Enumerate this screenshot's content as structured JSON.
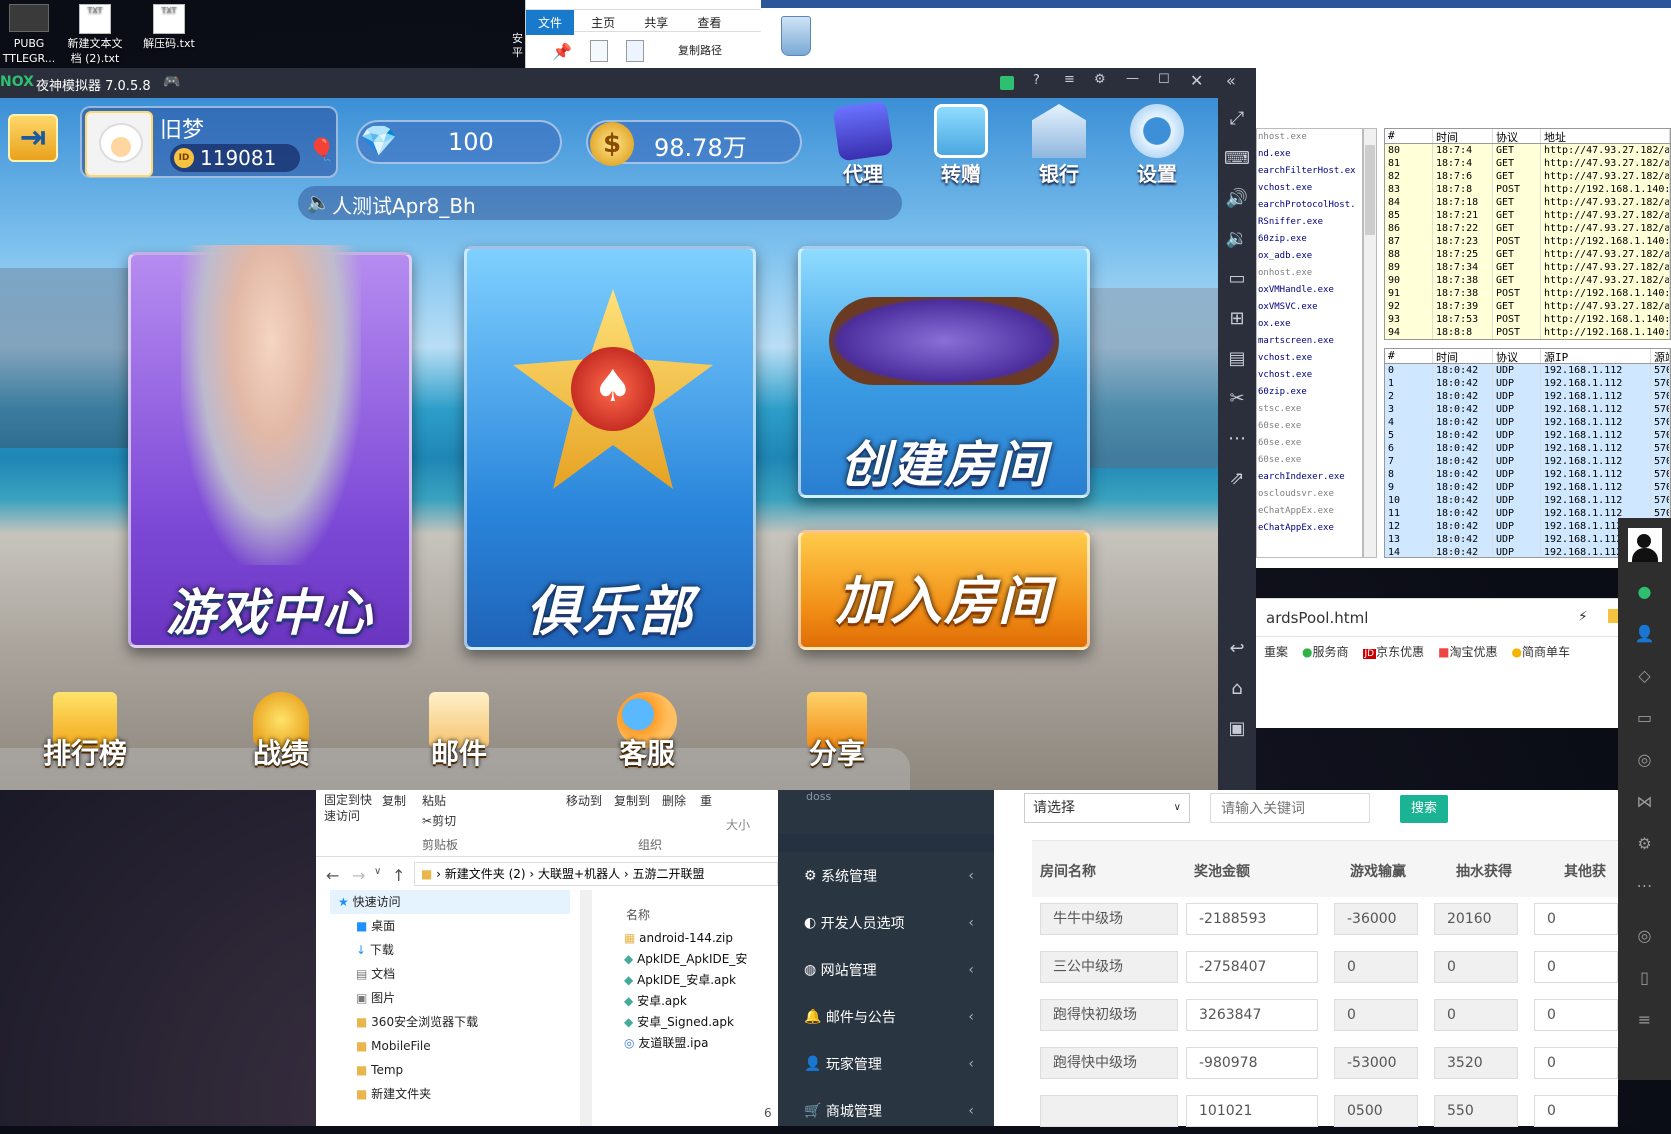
{
  "desktop": {
    "icons": [
      {
        "line1": "PUBG",
        "line2": "TTLEGR..."
      },
      {
        "line1": "新建文本文",
        "line2": "档 (2).txt",
        "badge": "TXT"
      },
      {
        "line1": "解压码.txt",
        "line2": "",
        "badge": "TXT"
      }
    ]
  },
  "explorer_top": {
    "tabs": [
      "文件",
      "主页",
      "共享",
      "查看"
    ],
    "copy_path": "复制路径",
    "side_text": [
      "安",
      "平"
    ]
  },
  "nox": {
    "title": "夜神模拟器 7.0.5.8",
    "logo": "NOX",
    "colors": {
      "titlebar": "#2b2f3b",
      "accent_green": "#2fbf71"
    }
  },
  "game": {
    "player_name": "旧梦",
    "player_id": "119081",
    "id_badge": "ID",
    "diamonds": "100",
    "gold": "98.78万",
    "top_icons": [
      "代理",
      "转赠",
      "银行",
      "设置"
    ],
    "marquee": "人测试Apr8_Bh",
    "panels": {
      "game_center": "游戏中心",
      "club": "俱乐部",
      "create_room": "创建房间",
      "join_room": "加入房间"
    },
    "bottom_icons": [
      "排行榜",
      "战绩",
      "邮件",
      "客服",
      "分享"
    ]
  },
  "sniffer": {
    "process_list": [
      "nhost.exe",
      "nd.exe",
      "earchFilterHost.ex",
      "vchost.exe",
      "earchProtocolHost.",
      "RSniffer.exe",
      "60zip.exe",
      "ox_adb.exe",
      "onhost.exe",
      "oxVMHandle.exe",
      "oxVMSVC.exe",
      "ox.exe",
      "martscreen.exe",
      "vchost.exe",
      "vchost.exe",
      "60zip.exe",
      "stsc.exe",
      "60se.exe",
      "60se.exe",
      "60se.exe",
      "earchIndexer.exe",
      "oscloudsvr.exe",
      "eChatAppEx.exe",
      "eChatAppEx.exe"
    ],
    "req_headers": [
      "#",
      "时间",
      "协议",
      "地址"
    ],
    "req_rows": [
      [
        "80",
        "18:7:4",
        "GET",
        "http://47.93.27.182/a"
      ],
      [
        "81",
        "18:7:4",
        "GET",
        "http://47.93.27.182/a"
      ],
      [
        "82",
        "18:7:6",
        "GET",
        "http://47.93.27.182/a"
      ],
      [
        "83",
        "18:7:8",
        "POST",
        "http://192.168.1.140:5"
      ],
      [
        "84",
        "18:7:18",
        "GET",
        "http://47.93.27.182/a"
      ],
      [
        "85",
        "18:7:21",
        "GET",
        "http://47.93.27.182/a"
      ],
      [
        "86",
        "18:7:22",
        "GET",
        "http://47.93.27.182/a"
      ],
      [
        "87",
        "18:7:23",
        "POST",
        "http://192.168.1.140:5"
      ],
      [
        "88",
        "18:7:25",
        "GET",
        "http://47.93.27.182/a"
      ],
      [
        "89",
        "18:7:34",
        "GET",
        "http://47.93.27.182/a"
      ],
      [
        "90",
        "18:7:38",
        "GET",
        "http://47.93.27.182/a"
      ],
      [
        "91",
        "18:7:38",
        "POST",
        "http://192.168.1.140:5"
      ],
      [
        "92",
        "18:7:39",
        "GET",
        "http://47.93.27.182/a"
      ],
      [
        "93",
        "18:7:53",
        "POST",
        "http://192.168.1.140:5"
      ],
      [
        "94",
        "18:8:8",
        "POST",
        "http://192.168.1.140:5"
      ]
    ],
    "udp_headers": [
      "#",
      "时间",
      "协议",
      "源IP",
      "源端"
    ],
    "udp_rows": [
      [
        "0",
        "18:0:42",
        "UDP",
        "192.168.1.112",
        "570"
      ],
      [
        "1",
        "18:0:42",
        "UDP",
        "192.168.1.112",
        "570"
      ],
      [
        "2",
        "18:0:42",
        "UDP",
        "192.168.1.112",
        "570"
      ],
      [
        "3",
        "18:0:42",
        "UDP",
        "192.168.1.112",
        "570"
      ],
      [
        "4",
        "18:0:42",
        "UDP",
        "192.168.1.112",
        "570"
      ],
      [
        "5",
        "18:0:42",
        "UDP",
        "192.168.1.112",
        "570"
      ],
      [
        "6",
        "18:0:42",
        "UDP",
        "192.168.1.112",
        "570"
      ],
      [
        "7",
        "18:0:42",
        "UDP",
        "192.168.1.112",
        "570"
      ],
      [
        "8",
        "18:0:42",
        "UDP",
        "192.168.1.112",
        "570"
      ],
      [
        "9",
        "18:0:42",
        "UDP",
        "192.168.1.112",
        "570"
      ],
      [
        "10",
        "18:0:42",
        "UDP",
        "192.168.1.112",
        "570"
      ],
      [
        "11",
        "18:0:42",
        "UDP",
        "192.168.1.112",
        "570"
      ],
      [
        "12",
        "18:0:42",
        "UDP",
        "192.168.1.112",
        "570"
      ],
      [
        "13",
        "18:0:42",
        "UDP",
        "192.168.1.112",
        "570"
      ],
      [
        "14",
        "18:0:42",
        "UDP",
        "192.168.1.112",
        "570"
      ]
    ]
  },
  "browser": {
    "tab_title": "ardsPool.html",
    "bookmarks": [
      "重案",
      "服务商",
      "京东优惠",
      "淘宝优惠",
      "简商单车"
    ]
  },
  "explorer_bottom": {
    "ribbon": [
      "固定到快",
      "速访问",
      "复制",
      "粘贴",
      "剪切",
      "剪贴板",
      "移动到",
      "复制到",
      "删除",
      "重",
      "组织",
      "大小"
    ],
    "breadcrumb": [
      "新建文件夹 (2)",
      "大联盟+机器人",
      "五游二开联盟"
    ],
    "nav": [
      "快速访问",
      "桌面",
      "下载",
      "文档",
      "图片",
      "360安全浏览器下载",
      "MobileFile",
      "Temp",
      "新建文件夹"
    ],
    "column": "名称",
    "files": [
      "android-144.zip",
      "ApkIDE_ApkIDE_安",
      "ApkIDE_安卓.apk",
      "安卓.apk",
      "安卓_Signed.apk",
      "友道联盟.ipa"
    ],
    "side_num": "6"
  },
  "admin": {
    "user_label": "doss",
    "menu": [
      "系统管理",
      "开发人员选项",
      "网站管理",
      "邮件与公告",
      "玩家管理",
      "商城管理"
    ],
    "select_placeholder": "请选择",
    "search_placeholder": "请输入关键词",
    "search_button": "搜索",
    "columns": [
      "房间名称",
      "奖池金额",
      "游戏输赢",
      "抽水获得",
      "其他获"
    ],
    "rows": [
      [
        "牛牛中级场",
        "-2188593",
        "-36000",
        "20160",
        "0"
      ],
      [
        "三公中级场",
        "-2758407",
        "0",
        "0",
        "0"
      ],
      [
        "跑得快初级场",
        "3263847",
        "0",
        "0",
        "0"
      ],
      [
        "跑得快中级场",
        "-980978",
        "-53000",
        "3520",
        "0"
      ],
      [
        "",
        "101021",
        "0500",
        "550",
        "0"
      ]
    ],
    "accent": "#1ab394"
  }
}
